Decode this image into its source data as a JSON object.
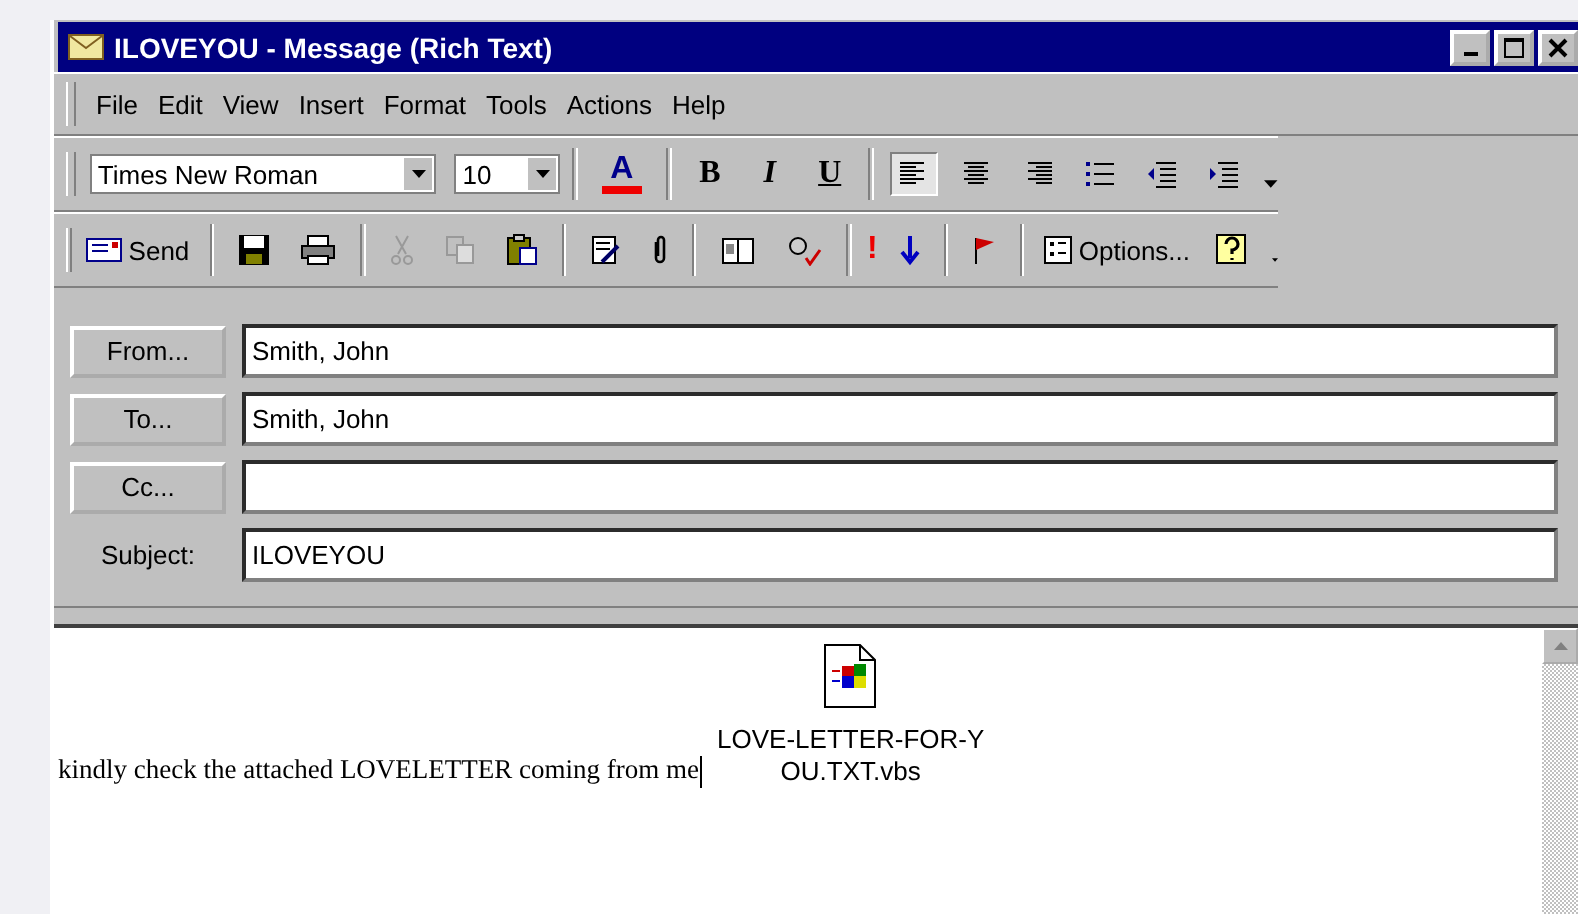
{
  "window": {
    "title": "ILOVEYOU - Message (Rich Text)"
  },
  "menu": [
    "File",
    "Edit",
    "View",
    "Insert",
    "Format",
    "Tools",
    "Actions",
    "Help"
  ],
  "format_toolbar": {
    "font": "Times New Roman",
    "size": "10",
    "buttons": [
      {
        "kind": "fontcolor",
        "label": "A"
      },
      {
        "kind": "bold",
        "label": "B"
      },
      {
        "kind": "italic",
        "label": "I"
      },
      {
        "kind": "underline",
        "label": "U"
      }
    ],
    "align": [
      {
        "kind": "left",
        "selected": true
      },
      {
        "kind": "center",
        "selected": false
      },
      {
        "kind": "right",
        "selected": false
      }
    ]
  },
  "standard_toolbar": {
    "send": "Send",
    "importance_high": "!",
    "options": "Options..."
  },
  "header": [
    {
      "kind": "button",
      "label": "From...",
      "value": "Smith, John"
    },
    {
      "kind": "button",
      "label": "To...",
      "value": "Smith, John"
    },
    {
      "kind": "button",
      "label": "Cc..."
    },
    {
      "kind": "label",
      "label": "Subject:",
      "value": "ILOVEYOU"
    }
  ],
  "body": {
    "text": "kindly check the attached LOVELETTER coming from me",
    "attachment_lines": [
      "LOVE-LETTER-FOR-Y",
      "OU.TXT.vbs"
    ]
  }
}
